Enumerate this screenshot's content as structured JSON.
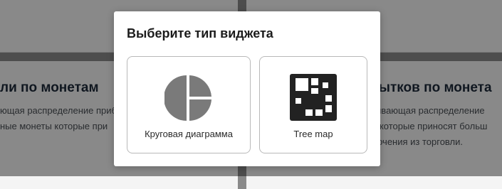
{
  "background": {
    "left_card": {
      "title": "ли по монетам",
      "desc_line1": "ющая распределение приб",
      "desc_line2": "ные монеты которые при"
    },
    "right_card": {
      "title": "бытков по монета",
      "desc_line1": "зывающая распределение",
      "desc_line2": "ы которые приносят больш",
      "desc_line3": "лючения из торговли."
    }
  },
  "modal": {
    "title": "Выберите тип виджета",
    "options": [
      {
        "label": "Круговая диаграмма",
        "icon": "pie-chart-icon"
      },
      {
        "label": "Tree map",
        "icon": "treemap-icon"
      }
    ]
  },
  "colors": {
    "pie_icon": "#7a7a7a",
    "treemap_icon": "#222222",
    "overlay": "rgba(0,0,0,0.44)"
  }
}
